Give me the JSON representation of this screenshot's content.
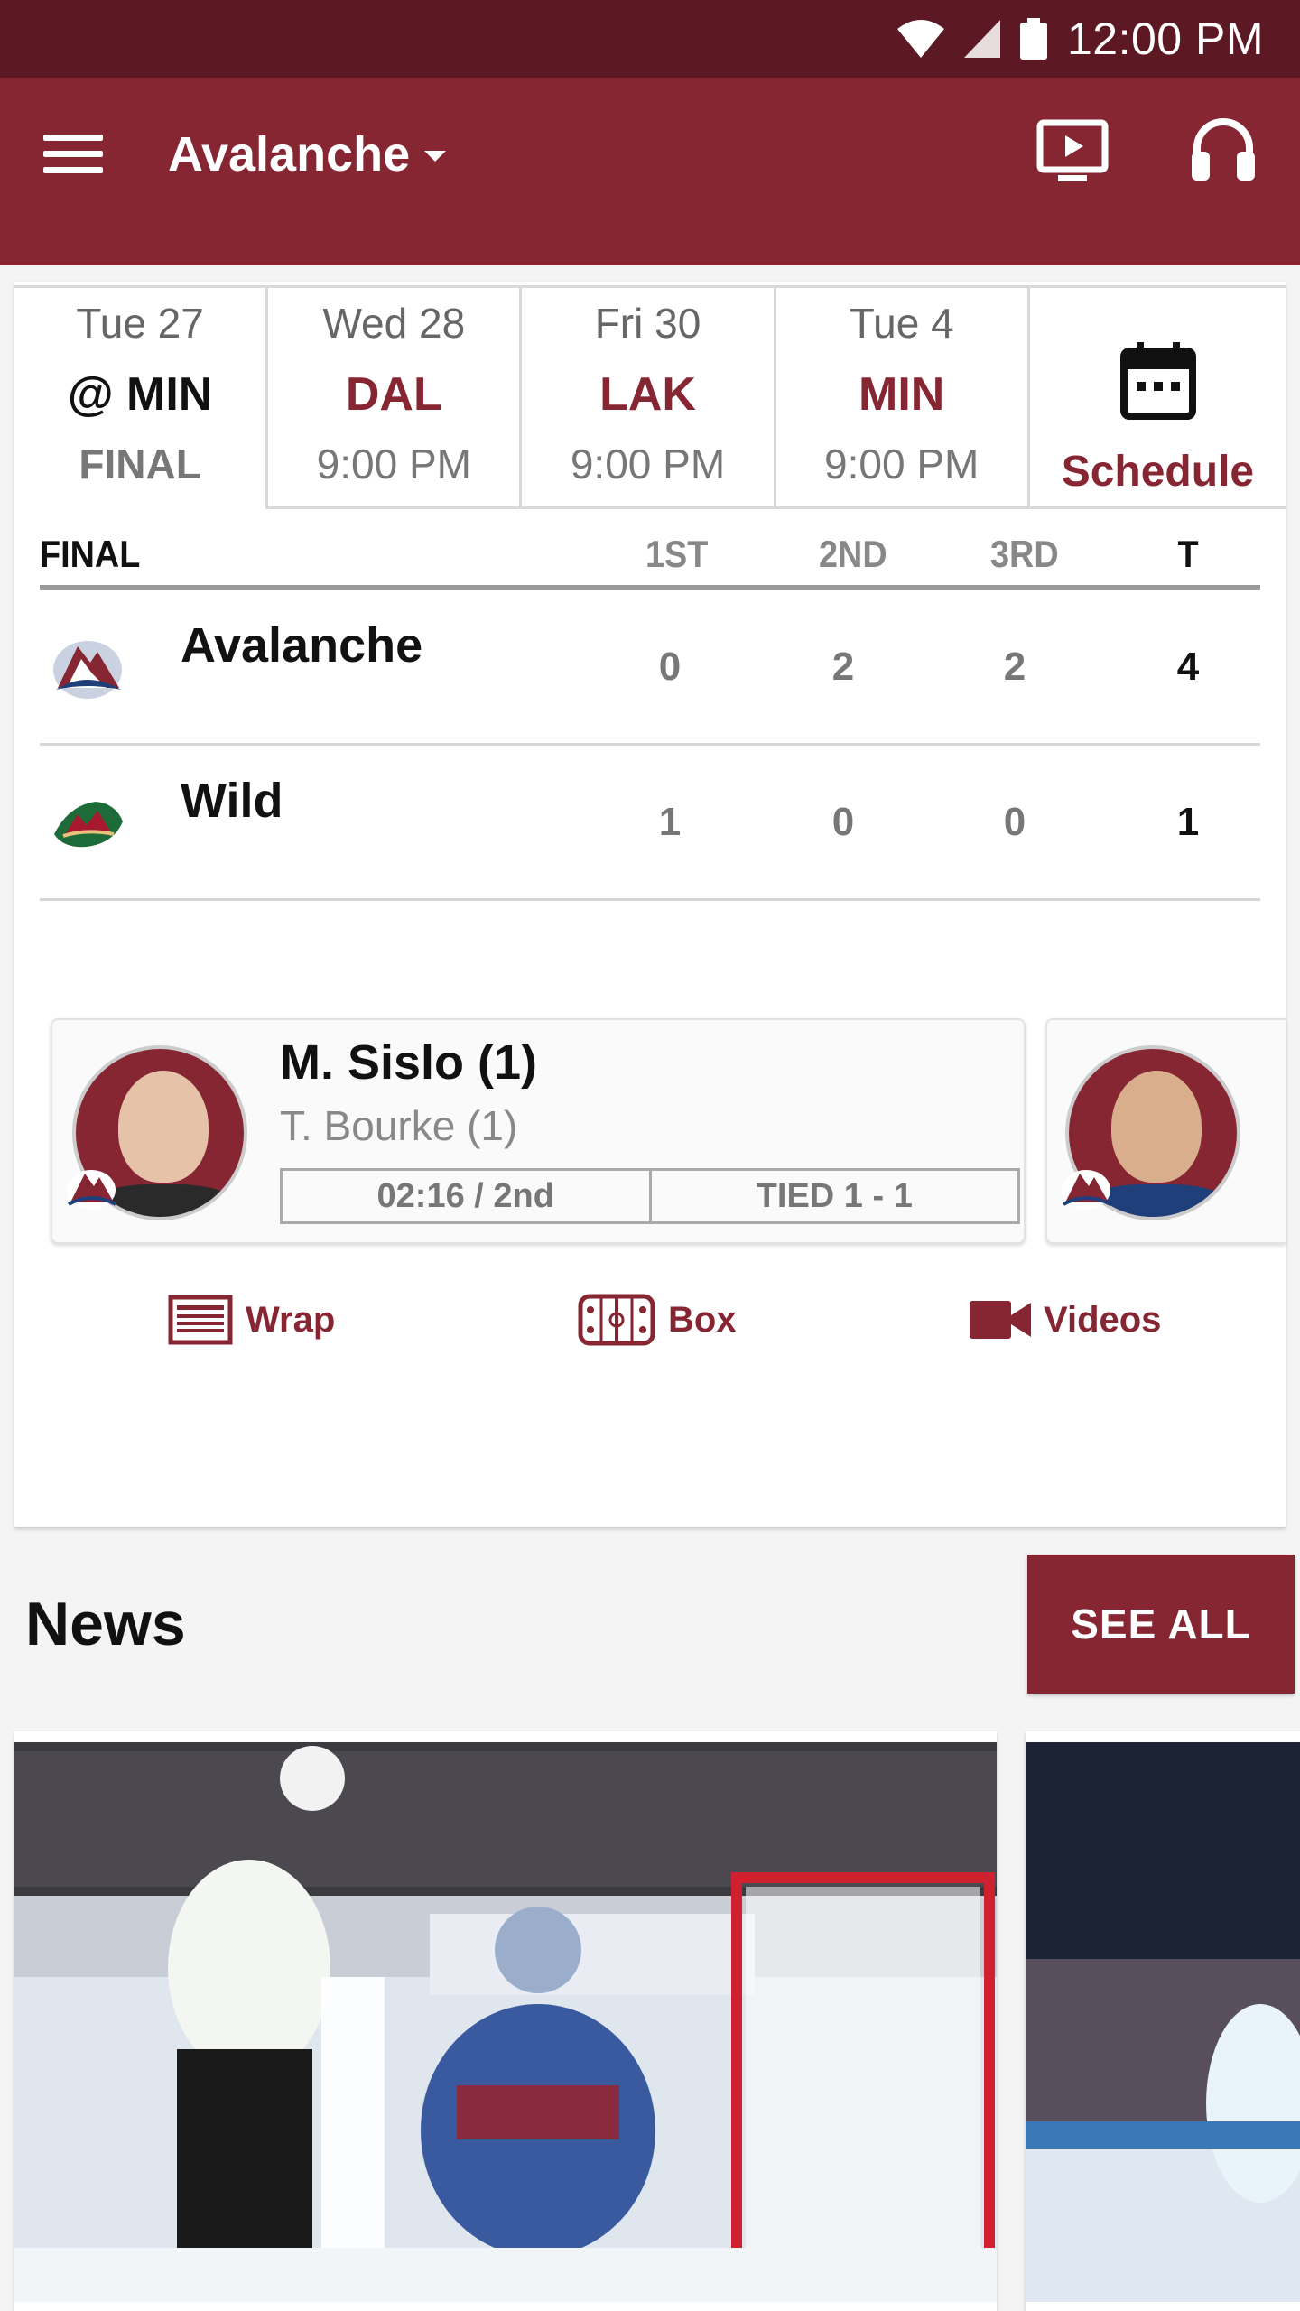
{
  "status_bar": {
    "time": "12:00 PM"
  },
  "app_bar": {
    "team": "Avalanche"
  },
  "game_tabs": [
    {
      "date": "Tue 27",
      "opponent": "@ MIN",
      "info": "FINAL"
    },
    {
      "date": "Wed 28",
      "opponent": "DAL",
      "info": "9:00 PM"
    },
    {
      "date": "Fri 30",
      "opponent": "LAK",
      "info": "9:00 PM"
    },
    {
      "date": "Tue 4",
      "opponent": "MIN",
      "info": "9:00 PM"
    }
  ],
  "schedule_label": "Schedule",
  "line_score": {
    "headers": {
      "status": "FINAL",
      "p1": "1ST",
      "p2": "2ND",
      "p3": "3RD",
      "total": "T"
    },
    "teams": [
      {
        "name": "Avalanche",
        "p1": "0",
        "p2": "2",
        "p3": "2",
        "total": "4"
      },
      {
        "name": "Wild",
        "p1": "1",
        "p2": "0",
        "p3": "0",
        "total": "1"
      }
    ]
  },
  "goal": {
    "scorer": "M. Sislo (1)",
    "assist": "T. Bourke (1)",
    "time": "02:16 / 2nd",
    "score_state": "TIED 1 - 1"
  },
  "actions": {
    "wrap": "Wrap",
    "box": "Box",
    "videos": "Videos"
  },
  "news": {
    "title": "News",
    "see_all": "SEE ALL"
  },
  "colors": {
    "brand": "#862633",
    "status_bar": "#5c1923"
  }
}
